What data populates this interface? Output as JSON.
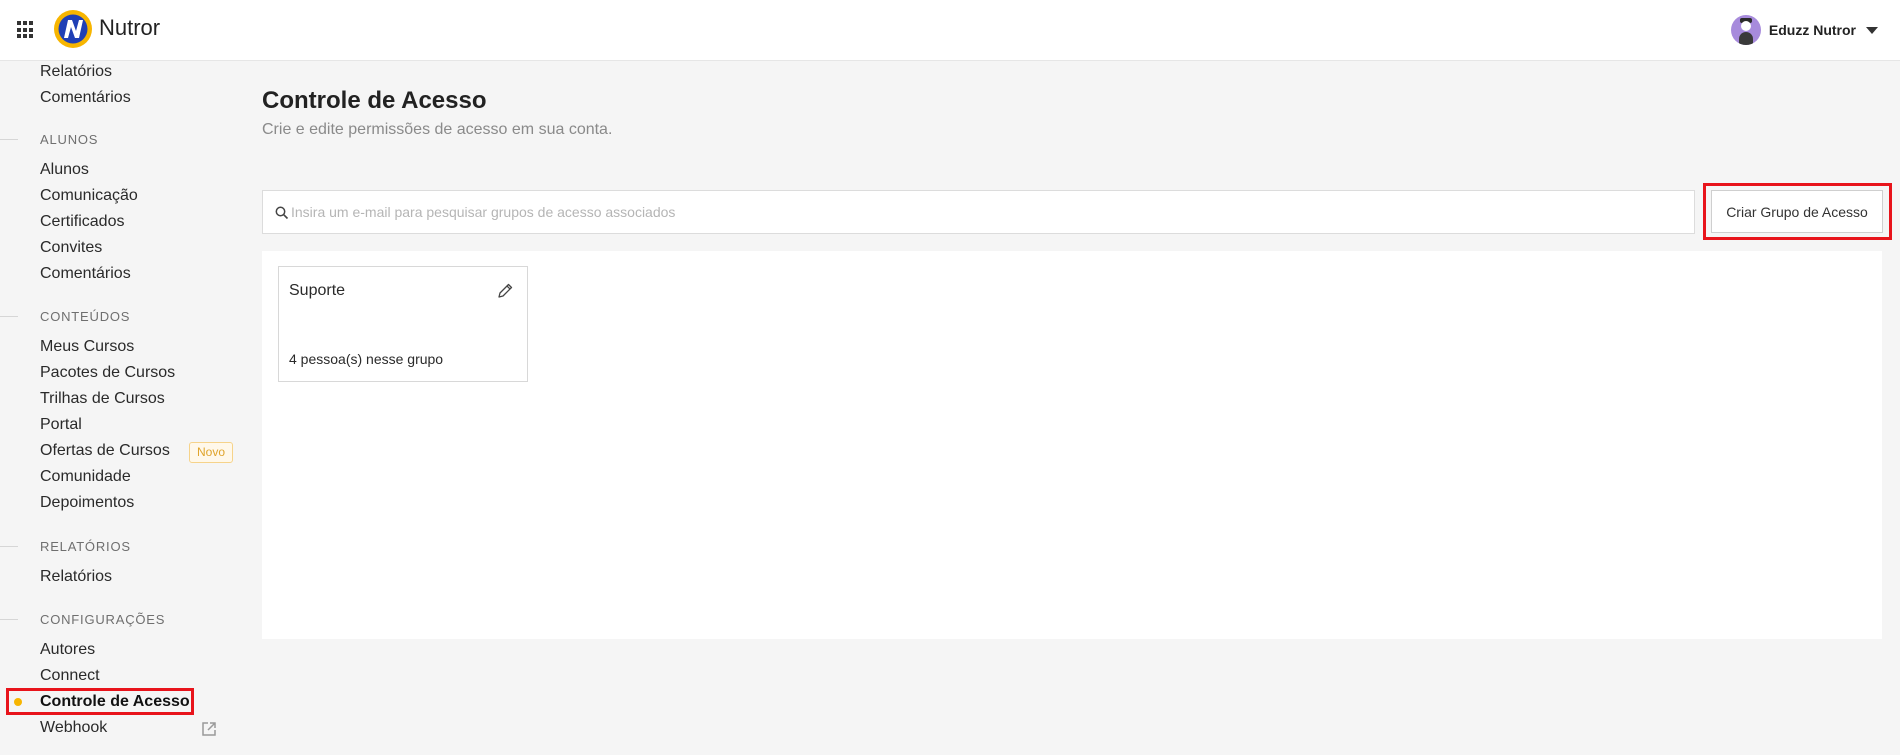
{
  "app": {
    "brand": "Nutror"
  },
  "user": {
    "name": "Eduzz Nutror"
  },
  "icons": [
    "apps-grid-icon",
    "nutror-logo-icon",
    "avatar",
    "chevron-down-icon",
    "external-link-icon",
    "search-icon",
    "pencil-icon"
  ],
  "colors": {
    "accent": "#f7b500",
    "highlight": "#e8141b",
    "badge_text": "#e0a42b"
  },
  "sidebar": {
    "top_items": [
      "Relatórios",
      "Comentários"
    ],
    "sections": [
      {
        "title": "ALUNOS",
        "items": [
          "Alunos",
          "Comunicação",
          "Certificados",
          "Convites",
          "Comentários"
        ]
      },
      {
        "title": "CONTEÚDOS",
        "items": [
          "Meus Cursos",
          "Pacotes de Cursos",
          "Trilhas de Cursos",
          "Portal",
          "Ofertas de Cursos",
          "Comunidade",
          "Depoimentos"
        ],
        "badge": "Novo"
      },
      {
        "title": "RELATÓRIOS",
        "items": [
          "Relatórios"
        ]
      },
      {
        "title": "CONFIGURAÇÕES",
        "items": [
          "Autores",
          "Connect",
          "Controle de Acesso",
          "Webhook"
        ]
      }
    ],
    "active_item": "Controle de Acesso"
  },
  "main": {
    "title": "Controle de Acesso",
    "subtitle": "Crie e edite permissões de acesso em sua conta.",
    "search_placeholder": "Insira um e-mail para pesquisar grupos de acesso associados",
    "create_button": "Criar Grupo de Acesso",
    "groups": [
      {
        "name": "Suporte",
        "count_text": "4 pessoa(s) nesse grupo"
      }
    ]
  }
}
